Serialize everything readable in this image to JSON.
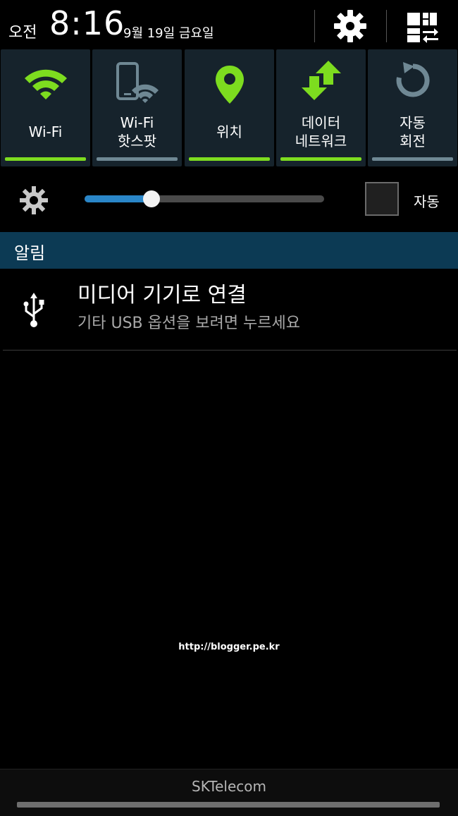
{
  "status": {
    "ampm": "오전",
    "time": "8:16",
    "date": "9월 19일 금요일"
  },
  "header": {
    "settings_icon": "gear-icon",
    "grid_icon": "quick-settings-grid-icon"
  },
  "toggles": [
    {
      "label": "Wi-Fi",
      "icon": "wifi-icon",
      "enabled": true
    },
    {
      "label": "Wi-Fi\n핫스팟",
      "icon": "hotspot-icon",
      "enabled": false
    },
    {
      "label": "위치",
      "icon": "location-icon",
      "enabled": true
    },
    {
      "label": "데이터\n네트워크",
      "icon": "data-network-icon",
      "enabled": true
    },
    {
      "label": "자동\n회전",
      "icon": "rotate-icon",
      "enabled": false
    }
  ],
  "brightness": {
    "level": 0.28,
    "auto_label": "자동",
    "auto_checked": false
  },
  "notifications": {
    "header": "알림",
    "items": [
      {
        "icon": "usb-icon",
        "title": "미디어 기기로 연결",
        "subtitle": "기타 USB 옵션을 보려면 누르세요"
      }
    ]
  },
  "watermark": "http://blogger.pe.kr",
  "footer": {
    "carrier": "SKTelecom"
  },
  "colors": {
    "accent_green": "#7ddc1f",
    "toggle_bg": "#16232c",
    "notif_header_bg": "#0c3a54",
    "slider_blue": "#2a86c8"
  }
}
